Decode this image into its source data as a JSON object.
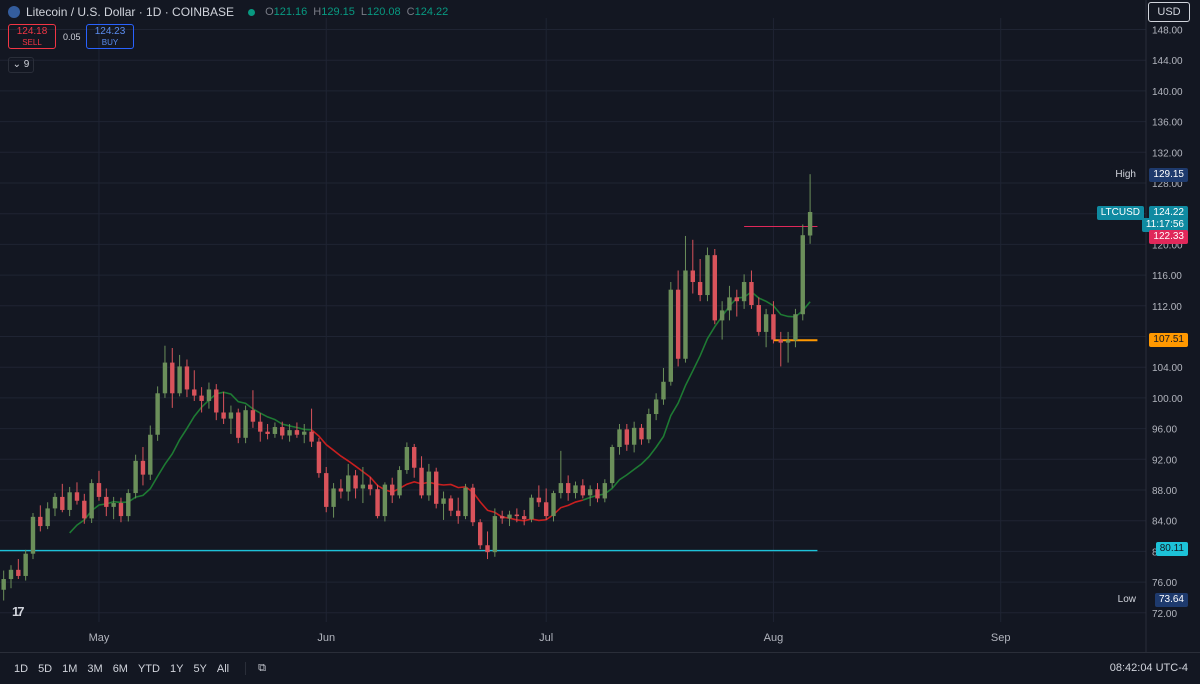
{
  "header": {
    "symbol_title": "Litecoin / U.S. Dollar · 1D · COINBASE",
    "open_label": "O",
    "open": "121.16",
    "high_label": "H",
    "high": "129.15",
    "low_label": "L",
    "low": "120.08",
    "close_label": "C",
    "close": "124.22"
  },
  "trade": {
    "sell_price": "124.18",
    "sell_label": "SELL",
    "spread": "0.05",
    "buy_price": "124.23",
    "buy_label": "BUY"
  },
  "indicator_toggle": "9",
  "currency": "USD",
  "price_tags": {
    "high_label": "High",
    "high_value": "129.15",
    "symbol": "LTCUSD",
    "last": "124.22",
    "countdown": "11:17:56",
    "level_red": "122.33",
    "level_orange": "107.51",
    "level_cyan": "80.11",
    "low_label": "Low",
    "low_value": "73.64"
  },
  "toolbar": {
    "timeframes": [
      "1D",
      "5D",
      "1M",
      "3M",
      "6M",
      "YTD",
      "1Y",
      "5Y",
      "All"
    ],
    "clock": "08:42:04 UTC-4"
  },
  "colors": {
    "background": "#131722",
    "up": "#6b8f5a",
    "down": "#d9535b",
    "teal": "#3fd0b0",
    "ma": "#1e7a33",
    "ma_red": "#c81f1f",
    "level_red": "#e0285a",
    "level_orange": "#ff9800",
    "level_cyan": "#1dc2d8"
  },
  "chart_data": {
    "type": "candlestick",
    "title": "Litecoin / U.S. Dollar · 1D · COINBASE",
    "y_ticks": [
      72,
      76,
      80,
      84,
      88,
      92,
      96,
      100,
      104,
      108,
      112,
      116,
      120,
      124,
      128,
      132,
      136,
      140,
      144,
      148
    ],
    "ylim": [
      70.8,
      149.5
    ],
    "x_ticks": [
      "May",
      "Jun",
      "Jul",
      "Aug",
      "Sep"
    ],
    "x_tick_days": [
      0,
      31,
      61,
      92,
      123
    ],
    "xlim": [
      -13.5,
      142
    ],
    "candles": [
      {
        "d": -13,
        "o": 75.0,
        "h": 77.5,
        "l": 73.6,
        "c": 76.4
      },
      {
        "d": -12,
        "o": 76.4,
        "h": 78.2,
        "l": 75.2,
        "c": 77.6
      },
      {
        "d": -11,
        "o": 77.6,
        "h": 79.0,
        "l": 76.4,
        "c": 76.8
      },
      {
        "d": -10,
        "o": 76.8,
        "h": 80.2,
        "l": 76.2,
        "c": 79.7
      },
      {
        "d": -9,
        "o": 79.7,
        "h": 85.0,
        "l": 79.0,
        "c": 84.5
      },
      {
        "d": -8,
        "o": 84.5,
        "h": 86.0,
        "l": 82.6,
        "c": 83.3
      },
      {
        "d": -7,
        "o": 83.3,
        "h": 86.4,
        "l": 82.9,
        "c": 85.6
      },
      {
        "d": -6,
        "o": 85.6,
        "h": 87.6,
        "l": 84.6,
        "c": 87.1
      },
      {
        "d": -5,
        "o": 87.1,
        "h": 88.8,
        "l": 85.1,
        "c": 85.4
      },
      {
        "d": -4,
        "o": 85.4,
        "h": 88.4,
        "l": 84.6,
        "c": 87.7
      },
      {
        "d": -3,
        "o": 87.7,
        "h": 89.0,
        "l": 86.1,
        "c": 86.6
      },
      {
        "d": -2,
        "o": 86.6,
        "h": 87.5,
        "l": 83.6,
        "c": 84.3
      },
      {
        "d": -1,
        "o": 84.3,
        "h": 89.4,
        "l": 83.7,
        "c": 88.9
      },
      {
        "d": 0,
        "o": 88.9,
        "h": 90.5,
        "l": 86.6,
        "c": 87.1
      },
      {
        "d": 1,
        "o": 87.1,
        "h": 88.2,
        "l": 84.6,
        "c": 85.8
      },
      {
        "d": 2,
        "o": 85.8,
        "h": 87.1,
        "l": 84.2,
        "c": 86.3
      },
      {
        "d": 3,
        "o": 86.3,
        "h": 87.0,
        "l": 83.8,
        "c": 84.6
      },
      {
        "d": 4,
        "o": 84.6,
        "h": 88.1,
        "l": 83.9,
        "c": 87.6
      },
      {
        "d": 5,
        "o": 87.6,
        "h": 92.6,
        "l": 86.9,
        "c": 91.8
      },
      {
        "d": 6,
        "o": 91.8,
        "h": 93.6,
        "l": 88.6,
        "c": 90.0
      },
      {
        "d": 7,
        "o": 90.0,
        "h": 96.4,
        "l": 89.3,
        "c": 95.2
      },
      {
        "d": 8,
        "o": 95.2,
        "h": 101.5,
        "l": 94.4,
        "c": 100.6
      },
      {
        "d": 9,
        "o": 100.6,
        "h": 106.8,
        "l": 100.0,
        "c": 104.6
      },
      {
        "d": 10,
        "o": 104.6,
        "h": 106.5,
        "l": 98.7,
        "c": 100.6
      },
      {
        "d": 11,
        "o": 100.6,
        "h": 105.6,
        "l": 100.2,
        "c": 104.1
      },
      {
        "d": 12,
        "o": 104.1,
        "h": 105.0,
        "l": 100.1,
        "c": 101.1
      },
      {
        "d": 13,
        "o": 101.1,
        "h": 103.6,
        "l": 99.6,
        "c": 100.3
      },
      {
        "d": 14,
        "o": 100.3,
        "h": 101.4,
        "l": 98.1,
        "c": 99.6
      },
      {
        "d": 15,
        "o": 99.6,
        "h": 102.0,
        "l": 98.6,
        "c": 101.1
      },
      {
        "d": 16,
        "o": 101.1,
        "h": 101.8,
        "l": 97.1,
        "c": 98.1
      },
      {
        "d": 17,
        "o": 98.1,
        "h": 100.8,
        "l": 96.6,
        "c": 97.3
      },
      {
        "d": 18,
        "o": 97.3,
        "h": 99.0,
        "l": 95.3,
        "c": 98.1
      },
      {
        "d": 19,
        "o": 98.1,
        "h": 98.6,
        "l": 94.1,
        "c": 94.8
      },
      {
        "d": 20,
        "o": 94.8,
        "h": 99.0,
        "l": 94.1,
        "c": 98.4
      },
      {
        "d": 21,
        "o": 98.4,
        "h": 101.0,
        "l": 96.1,
        "c": 96.9
      },
      {
        "d": 22,
        "o": 96.9,
        "h": 98.0,
        "l": 94.3,
        "c": 95.6
      },
      {
        "d": 23,
        "o": 95.6,
        "h": 96.6,
        "l": 94.6,
        "c": 95.3
      },
      {
        "d": 24,
        "o": 95.3,
        "h": 96.8,
        "l": 94.8,
        "c": 96.2
      },
      {
        "d": 25,
        "o": 96.2,
        "h": 96.9,
        "l": 94.6,
        "c": 95.1
      },
      {
        "d": 26,
        "o": 95.1,
        "h": 96.6,
        "l": 94.3,
        "c": 95.8
      },
      {
        "d": 27,
        "o": 95.8,
        "h": 96.8,
        "l": 94.8,
        "c": 95.2
      },
      {
        "d": 28,
        "o": 95.2,
        "h": 96.6,
        "l": 94.1,
        "c": 95.6
      },
      {
        "d": 29,
        "o": 95.6,
        "h": 98.6,
        "l": 93.6,
        "c": 94.3
      },
      {
        "d": 30,
        "o": 94.3,
        "h": 94.8,
        "l": 89.6,
        "c": 90.2
      },
      {
        "d": 31,
        "o": 90.2,
        "h": 91.0,
        "l": 85.1,
        "c": 85.8
      },
      {
        "d": 32,
        "o": 85.8,
        "h": 88.9,
        "l": 84.4,
        "c": 88.2
      },
      {
        "d": 33,
        "o": 88.2,
        "h": 89.4,
        "l": 86.9,
        "c": 87.8
      },
      {
        "d": 34,
        "o": 87.8,
        "h": 91.4,
        "l": 86.6,
        "c": 89.9
      },
      {
        "d": 35,
        "o": 89.9,
        "h": 90.6,
        "l": 86.9,
        "c": 88.2
      },
      {
        "d": 36,
        "o": 88.2,
        "h": 91.0,
        "l": 86.3,
        "c": 88.7
      },
      {
        "d": 37,
        "o": 88.7,
        "h": 89.7,
        "l": 87.3,
        "c": 88.1
      },
      {
        "d": 38,
        "o": 88.1,
        "h": 88.7,
        "l": 84.3,
        "c": 84.6
      },
      {
        "d": 39,
        "o": 84.6,
        "h": 89.0,
        "l": 83.9,
        "c": 88.7
      },
      {
        "d": 40,
        "o": 88.7,
        "h": 89.6,
        "l": 86.3,
        "c": 87.3
      },
      {
        "d": 41,
        "o": 87.3,
        "h": 91.1,
        "l": 86.9,
        "c": 90.6
      },
      {
        "d": 42,
        "o": 90.6,
        "h": 94.2,
        "l": 90.1,
        "c": 93.6
      },
      {
        "d": 43,
        "o": 93.6,
        "h": 94.0,
        "l": 89.6,
        "c": 90.9
      },
      {
        "d": 44,
        "o": 90.9,
        "h": 92.4,
        "l": 86.9,
        "c": 87.3
      },
      {
        "d": 45,
        "o": 87.3,
        "h": 91.4,
        "l": 86.6,
        "c": 90.4
      },
      {
        "d": 46,
        "o": 90.4,
        "h": 90.9,
        "l": 85.6,
        "c": 86.2
      },
      {
        "d": 47,
        "o": 86.2,
        "h": 87.8,
        "l": 84.1,
        "c": 86.9
      },
      {
        "d": 48,
        "o": 86.9,
        "h": 87.3,
        "l": 84.6,
        "c": 85.3
      },
      {
        "d": 49,
        "o": 85.3,
        "h": 87.0,
        "l": 83.6,
        "c": 84.6
      },
      {
        "d": 50,
        "o": 84.6,
        "h": 88.8,
        "l": 84.2,
        "c": 88.3
      },
      {
        "d": 51,
        "o": 88.3,
        "h": 88.8,
        "l": 83.3,
        "c": 83.8
      },
      {
        "d": 52,
        "o": 83.8,
        "h": 84.2,
        "l": 80.3,
        "c": 80.8
      },
      {
        "d": 53,
        "o": 80.8,
        "h": 82.6,
        "l": 79.0,
        "c": 79.9
      },
      {
        "d": 54,
        "o": 79.9,
        "h": 85.6,
        "l": 79.3,
        "c": 84.6
      },
      {
        "d": 55,
        "o": 84.6,
        "h": 85.3,
        "l": 83.6,
        "c": 84.3
      },
      {
        "d": 56,
        "o": 84.3,
        "h": 85.3,
        "l": 83.3,
        "c": 84.8
      },
      {
        "d": 57,
        "o": 84.8,
        "h": 85.6,
        "l": 83.8,
        "c": 84.6
      },
      {
        "d": 58,
        "o": 84.6,
        "h": 85.4,
        "l": 83.4,
        "c": 84.2
      },
      {
        "d": 59,
        "o": 84.2,
        "h": 87.4,
        "l": 83.8,
        "c": 87.0
      },
      {
        "d": 60,
        "o": 87.0,
        "h": 88.6,
        "l": 85.8,
        "c": 86.4
      },
      {
        "d": 61,
        "o": 86.4,
        "h": 88.2,
        "l": 84.1,
        "c": 84.6
      },
      {
        "d": 62,
        "o": 84.6,
        "h": 87.9,
        "l": 83.9,
        "c": 87.6
      },
      {
        "d": 63,
        "o": 87.6,
        "h": 93.1,
        "l": 86.9,
        "c": 88.9
      },
      {
        "d": 64,
        "o": 88.9,
        "h": 89.9,
        "l": 86.6,
        "c": 87.6
      },
      {
        "d": 65,
        "o": 87.6,
        "h": 89.1,
        "l": 86.9,
        "c": 88.6
      },
      {
        "d": 66,
        "o": 88.6,
        "h": 89.4,
        "l": 86.9,
        "c": 87.3
      },
      {
        "d": 67,
        "o": 87.3,
        "h": 88.6,
        "l": 85.9,
        "c": 88.1
      },
      {
        "d": 68,
        "o": 88.1,
        "h": 88.9,
        "l": 86.4,
        "c": 86.9
      },
      {
        "d": 69,
        "o": 86.9,
        "h": 89.4,
        "l": 86.4,
        "c": 88.9
      },
      {
        "d": 70,
        "o": 88.9,
        "h": 93.9,
        "l": 88.3,
        "c": 93.6
      },
      {
        "d": 71,
        "o": 93.6,
        "h": 96.6,
        "l": 92.6,
        "c": 95.9
      },
      {
        "d": 72,
        "o": 95.9,
        "h": 96.6,
        "l": 93.1,
        "c": 93.9
      },
      {
        "d": 73,
        "o": 93.9,
        "h": 96.9,
        "l": 92.9,
        "c": 96.1
      },
      {
        "d": 74,
        "o": 96.1,
        "h": 96.6,
        "l": 93.9,
        "c": 94.6
      },
      {
        "d": 75,
        "o": 94.6,
        "h": 98.6,
        "l": 94.1,
        "c": 97.9
      },
      {
        "d": 76,
        "o": 97.9,
        "h": 100.6,
        "l": 97.1,
        "c": 99.8
      },
      {
        "d": 77,
        "o": 99.8,
        "h": 103.9,
        "l": 99.1,
        "c": 102.1
      },
      {
        "d": 78,
        "o": 102.1,
        "h": 115.1,
        "l": 101.6,
        "c": 114.1
      },
      {
        "d": 79,
        "o": 114.1,
        "h": 116.6,
        "l": 104.1,
        "c": 105.1
      },
      {
        "d": 80,
        "o": 105.1,
        "h": 121.1,
        "l": 104.6,
        "c": 116.6
      },
      {
        "d": 81,
        "o": 116.6,
        "h": 120.6,
        "l": 113.6,
        "c": 115.1
      },
      {
        "d": 82,
        "o": 115.1,
        "h": 118.1,
        "l": 112.6,
        "c": 113.4
      },
      {
        "d": 83,
        "o": 113.4,
        "h": 119.6,
        "l": 112.6,
        "c": 118.6
      },
      {
        "d": 84,
        "o": 118.6,
        "h": 119.4,
        "l": 109.6,
        "c": 110.1
      },
      {
        "d": 85,
        "o": 110.1,
        "h": 112.6,
        "l": 107.6,
        "c": 111.4
      },
      {
        "d": 86,
        "o": 111.4,
        "h": 114.6,
        "l": 110.1,
        "c": 113.1
      },
      {
        "d": 87,
        "o": 113.1,
        "h": 114.1,
        "l": 110.6,
        "c": 112.6
      },
      {
        "d": 88,
        "o": 112.6,
        "h": 116.1,
        "l": 111.6,
        "c": 115.1
      },
      {
        "d": 89,
        "o": 115.1,
        "h": 116.6,
        "l": 111.6,
        "c": 112.1
      },
      {
        "d": 90,
        "o": 112.1,
        "h": 113.1,
        "l": 108.1,
        "c": 108.6
      },
      {
        "d": 91,
        "o": 108.6,
        "h": 111.6,
        "l": 106.6,
        "c": 110.9
      },
      {
        "d": 92,
        "o": 110.9,
        "h": 112.6,
        "l": 107.1,
        "c": 107.6
      },
      {
        "d": 93,
        "o": 107.6,
        "h": 108.6,
        "l": 104.1,
        "c": 107.2
      },
      {
        "d": 94,
        "o": 107.2,
        "h": 108.6,
        "l": 104.6,
        "c": 107.5
      },
      {
        "d": 95,
        "o": 107.5,
        "h": 111.6,
        "l": 106.6,
        "c": 110.9
      },
      {
        "d": 96,
        "o": 110.9,
        "h": 122.6,
        "l": 110.1,
        "c": 121.2
      },
      {
        "d": 97,
        "o": 121.16,
        "h": 129.15,
        "l": 120.08,
        "c": 124.22
      }
    ]
  }
}
